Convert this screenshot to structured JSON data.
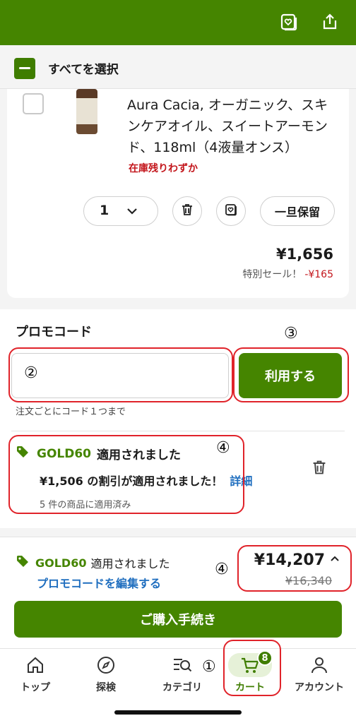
{
  "select_all": {
    "label": "すべてを選択"
  },
  "product": {
    "title": "Aura Cacia, オーガニック、スキンケアオイル、スイートアーモンド、118ml（4液量オンス）",
    "stock": "在庫残りわずか",
    "quantity": "1",
    "hold_label": "一旦保留",
    "price": "¥1,656",
    "sale_label": "特別セール！",
    "sale_discount": "-¥165"
  },
  "promo": {
    "label": "プロモコード",
    "input_value": "",
    "input_placeholder": "",
    "apply_label": "利用する",
    "note": "注文ごとにコード１つまで",
    "applied_code": "GOLD60",
    "applied_text": "適用されました",
    "discount_text": "¥1,506 の割引が適用されました！",
    "detail_link": "詳細",
    "applied_count": "5 件の商品に適用済み"
  },
  "summary": {
    "code": "GOLD60",
    "applied_text": "適用されました",
    "edit_link": "プロモコードを編集する",
    "total": "¥14,207",
    "original": "¥16,340",
    "checkout_label": "ご購入手続き"
  },
  "tabs": [
    {
      "label": "トップ",
      "icon": "home-icon"
    },
    {
      "label": "探検",
      "icon": "compass-icon"
    },
    {
      "label": "カテゴリ",
      "icon": "category-search-icon"
    },
    {
      "label": "カート",
      "icon": "cart-icon",
      "badge": "8",
      "active": true
    },
    {
      "label": "アカウント",
      "icon": "account-icon"
    }
  ],
  "markers": {
    "m1": "①",
    "m2": "②",
    "m3": "③",
    "m4a": "④",
    "m4b": "④"
  },
  "colors": {
    "brand": "#458500",
    "highlight": "#e0232a",
    "link": "#1f6ebf",
    "warning": "#c3151b"
  }
}
